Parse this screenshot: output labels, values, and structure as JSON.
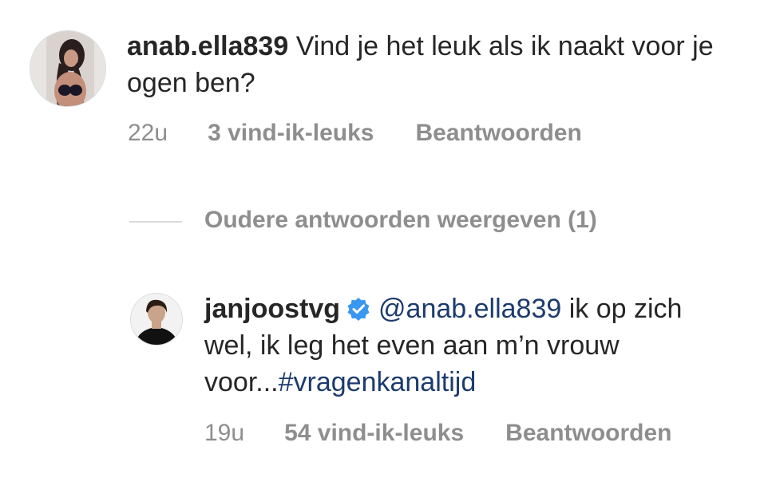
{
  "colors": {
    "text": "#262626",
    "secondary": "#8e8e8e",
    "link": "#1d3b6e",
    "verified": "#3897f0",
    "divider": "#dbdbdb"
  },
  "comment": {
    "username": "anab.ella839",
    "text": "Vind je het leuk als ik naakt voor je ogen ben?",
    "time": "22u",
    "likes": "3 vind-ik-leuks",
    "reply_label": "Beantwoorden",
    "avatar_icon": "profile-photo-icon"
  },
  "replies": {
    "view_older_label": "Oudere antwoorden weergeven (1)"
  },
  "reply": {
    "username": "janjoostvg",
    "verified_icon": "verified-badge-icon",
    "mention": "@anab.ella839",
    "text_part1": " ik op zich wel, ik leg het even aan m’n vrouw voor...",
    "hashtag": "#vragenkanaltijd",
    "time": "19u",
    "likes": "54 vind-ik-leuks",
    "reply_label": "Beantwoorden",
    "avatar_icon": "profile-photo-icon"
  }
}
